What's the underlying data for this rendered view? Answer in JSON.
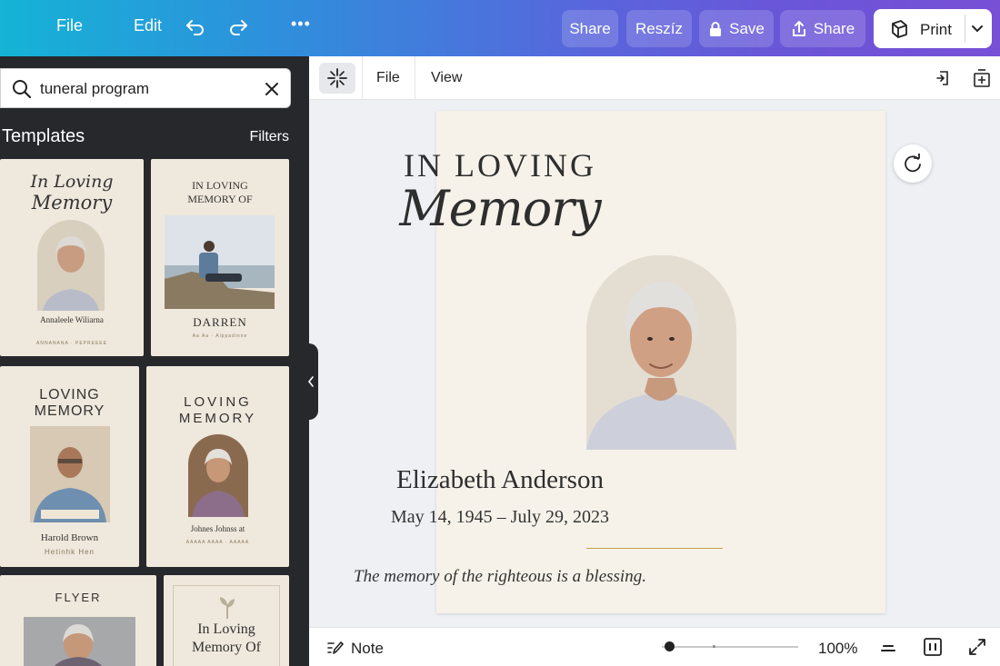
{
  "topbar": {
    "file_label": "File",
    "edit_label": "Edit",
    "more_label": "•••",
    "share1_label": "Share",
    "resize_label": "Reszíz",
    "save_label": "Save",
    "share2_label": "Share",
    "print_label": "Print"
  },
  "search": {
    "value": "tuneral program"
  },
  "panel": {
    "title": "Templates",
    "filters_label": "Filters"
  },
  "templates": [
    {
      "script1": "In Loving",
      "script2": "Memory",
      "name": "Annaleele Wiliarna",
      "sub": "ANNANANA · PEPREEEE"
    },
    {
      "line1": "IN LOVING",
      "line2": "MEMORY OF",
      "name": "DARREN",
      "sub": "Aa Aa · Alppadinne"
    },
    {
      "line1": "LOVING",
      "line2": "MEMORY",
      "name": "Harold Brown",
      "sub": "Hetinhk Hen"
    },
    {
      "line1": "LOVING",
      "line2": "MEMORY",
      "name": "Johnes Johnss at",
      "sub": "AAAAA AAAA · AAAAA"
    },
    {
      "line1": "FLYER"
    },
    {
      "line1": "In Loving",
      "line2": "Memory Of"
    }
  ],
  "editor": {
    "file_label": "File",
    "view_label": "View"
  },
  "design": {
    "headline": "IN LOVING",
    "script": "Memory",
    "name": "Elizabeth Anderson",
    "dates": "May 14, 1945 – July 29, 2023",
    "verse": "The memory of the righteous is a blessing."
  },
  "bottombar": {
    "note_label": "Note",
    "zoom": "100%",
    "zoom_slider_level": 0.05
  },
  "colors": {
    "gradient_start": "#15b3d6",
    "gradient_end": "#7750d6",
    "panel_bg": "#26282c",
    "page_bg": "#f6f2ea",
    "accent_gold": "#c8a24a"
  }
}
